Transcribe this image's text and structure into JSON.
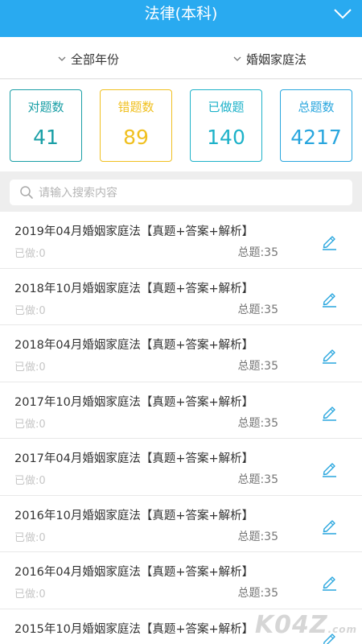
{
  "header": {
    "title": "法律(本科)",
    "menu_icon": "chevron-down-icon"
  },
  "filters": {
    "year": "全部年份",
    "subject": "婚姻家庭法"
  },
  "stats": [
    {
      "label": "对题数",
      "value": "41",
      "color": "#1a9fa6"
    },
    {
      "label": "错题数",
      "value": "89",
      "color": "#f0c020"
    },
    {
      "label": "已做题",
      "value": "140",
      "color": "#1eb2c9"
    },
    {
      "label": "总题数",
      "value": "4217",
      "color": "#29a6de"
    }
  ],
  "search": {
    "placeholder": "请输入搜索内容",
    "icon": "search-icon"
  },
  "papers": [
    {
      "title": "2019年04月婚姻家庭法【真题+答案+解析】",
      "done": "已做:0",
      "total": "总题:35"
    },
    {
      "title": "2018年10月婚姻家庭法【真题+答案+解析】",
      "done": "已做:0",
      "total": "总题:35"
    },
    {
      "title": "2018年04月婚姻家庭法【真题+答案+解析】",
      "done": "已做:0",
      "total": "总题:35"
    },
    {
      "title": "2017年10月婚姻家庭法【真题+答案+解析】",
      "done": "已做:0",
      "total": "总题:35"
    },
    {
      "title": "2017年04月婚姻家庭法【真题+答案+解析】",
      "done": "已做:0",
      "total": "总题:35"
    },
    {
      "title": "2016年10月婚姻家庭法【真题+答案+解析】",
      "done": "已做:0",
      "total": "总题:35"
    },
    {
      "title": "2016年04月婚姻家庭法【真题+答案+解析】",
      "done": "已做:0",
      "total": "总题:35"
    },
    {
      "title": "2015年10月婚姻家庭法【真题+答案+解析】",
      "done": "已做:0",
      "total": "总题:35"
    }
  ],
  "watermark": {
    "text": "K04Z",
    "suffix": ".com"
  },
  "colors": {
    "header_bg": "#29aaf0",
    "edit_icon": "#29a6de"
  }
}
